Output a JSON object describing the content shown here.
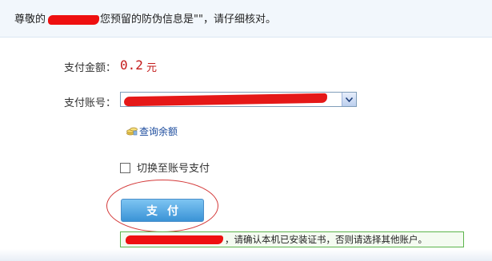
{
  "banner": {
    "greeting": "尊敬的",
    "tip": "您预留的防伪信息是\"\"，请仔细核对。"
  },
  "form": {
    "amount_label": "支付金额：",
    "amount_value": "0.2",
    "amount_unit": "元",
    "account_label": "支付账号：",
    "balance_link": "查询余额",
    "switch_label": "切换至账号支付",
    "switch_checked": false,
    "pay_button": "支付",
    "cert_notice": "，请确认本机已安装证书，否则请选择其他账户。"
  },
  "icons": {
    "balance": "coins-icon",
    "dropdown": "chevron-down-icon",
    "checkbox": "checkbox-icon"
  },
  "colors": {
    "amount": "#c31a1a",
    "link": "#1a4a9c",
    "button": "#3a93d6",
    "notice_border": "#5cb44c",
    "annotation": "#d43a3a",
    "redaction": "#ee1010"
  }
}
